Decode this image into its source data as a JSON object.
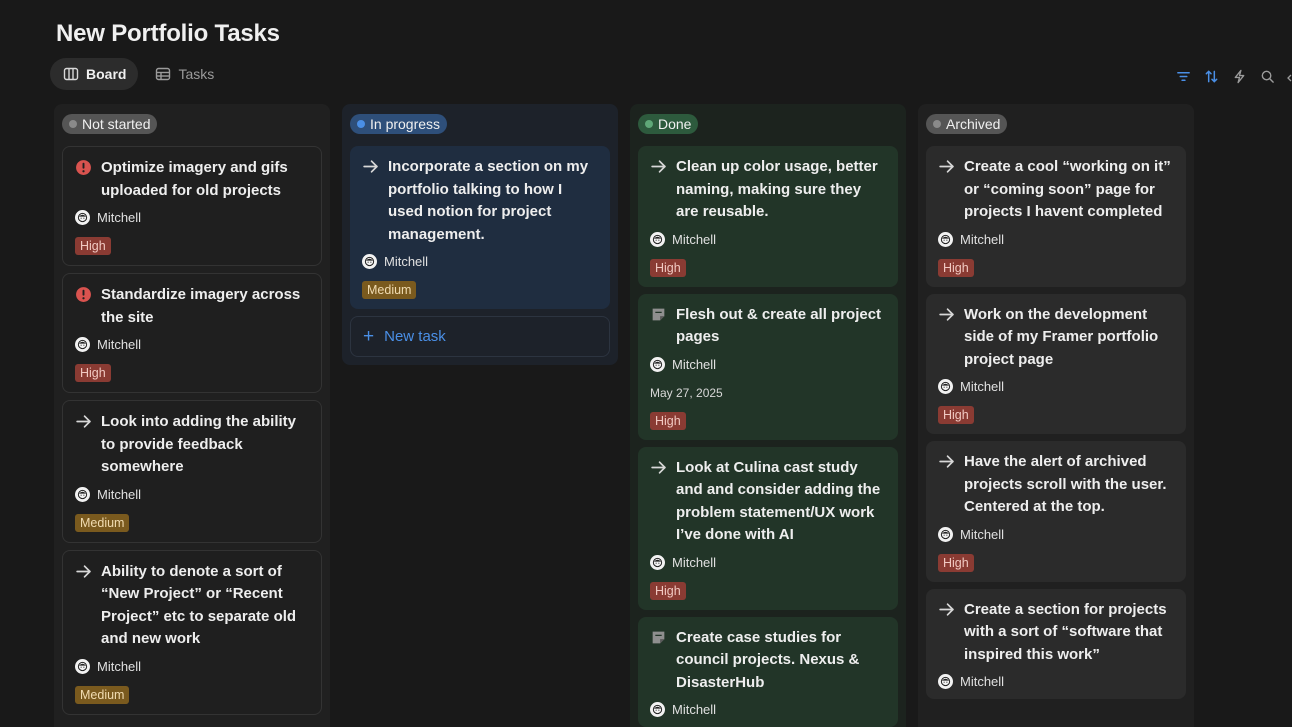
{
  "page": {
    "title": "New Portfolio Tasks"
  },
  "views": [
    {
      "label": "Board",
      "icon": "board-icon",
      "active": true
    },
    {
      "label": "Tasks",
      "icon": "table-icon",
      "active": false
    }
  ],
  "toolbar": {
    "icons": [
      "filter-icon",
      "sort-icon",
      "automation-icon",
      "search-icon"
    ]
  },
  "colors": {
    "accent": "#4a8fe6",
    "high": "#8a3b33",
    "medium": "#7a5a1e"
  },
  "columns": [
    {
      "status": "Not started",
      "cards": [
        {
          "title": "Optimize imagery and gifs uploaded for old projects",
          "icon": "alert-icon",
          "assignee": "Mitchell",
          "priority": "High"
        },
        {
          "title": "Standardize imagery across the site",
          "icon": "alert-icon",
          "assignee": "Mitchell",
          "priority": "High"
        },
        {
          "title": "Look into adding the ability to provide feedback somewhere",
          "icon": "arrow-icon",
          "assignee": "Mitchell",
          "priority": "Medium"
        },
        {
          "title": "Ability to denote a sort of “New Project” or “Recent Project” etc to separate old and new work",
          "icon": "arrow-icon",
          "assignee": "Mitchell",
          "priority": "Medium"
        }
      ]
    },
    {
      "status": "In progress",
      "cards": [
        {
          "title": "Incorporate a section on my portfolio talking to how I used notion for project management.",
          "icon": "arrow-icon",
          "assignee": "Mitchell",
          "priority": "Medium"
        }
      ],
      "new_task_label": "New task"
    },
    {
      "status": "Done",
      "cards": [
        {
          "title": "Clean up color usage, better naming, making sure they are reusable.",
          "icon": "arrow-icon",
          "assignee": "Mitchell",
          "priority": "High"
        },
        {
          "title": "Flesh out & create all project pages",
          "icon": "page-icon",
          "assignee": "Mitchell",
          "date": "May 27, 2025",
          "priority": "High"
        },
        {
          "title": "Look at Culina cast study and and consider adding the problem statement/UX work I’ve done with AI",
          "icon": "arrow-icon",
          "assignee": "Mitchell",
          "priority": "High"
        },
        {
          "title": "Create case studies for council projects. Nexus & DisasterHub",
          "icon": "page-icon",
          "assignee": "Mitchell"
        }
      ]
    },
    {
      "status": "Archived",
      "cards": [
        {
          "title": "Create a cool “working on it” or “coming soon” page for projects I havent completed",
          "icon": "arrow-icon",
          "assignee": "Mitchell",
          "priority": "High"
        },
        {
          "title": "Work on the development side of my Framer portfolio project page",
          "icon": "arrow-icon",
          "assignee": "Mitchell",
          "priority": "High"
        },
        {
          "title": "Have the alert of archived projects scroll with the user. Centered at the top.",
          "icon": "arrow-icon",
          "assignee": "Mitchell",
          "priority": "High"
        },
        {
          "title": "Create a section for projects with a sort of “software that inspired this work”",
          "icon": "arrow-icon",
          "assignee": "Mitchell"
        }
      ]
    }
  ]
}
